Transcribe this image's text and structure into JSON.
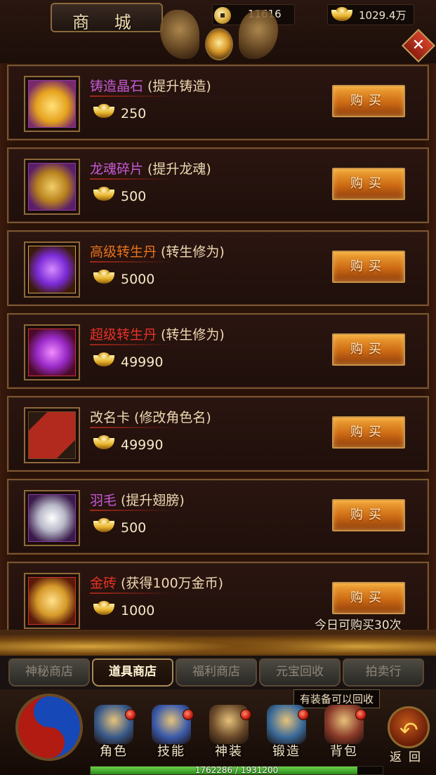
{
  "header": {
    "title": "商 城",
    "coins": "11616",
    "ingots": "1029.4万",
    "close_icon": "close-icon"
  },
  "items": [
    {
      "name": "铸造晶石",
      "desc": "(提升铸造)",
      "price": "250",
      "buy": "购买",
      "name_color": "#c65ad6",
      "icon": "crystal-icon"
    },
    {
      "name": "龙魂碎片",
      "desc": "(提升龙魂)",
      "price": "500",
      "buy": "购买",
      "name_color": "#c65ad6",
      "icon": "dragon-soul-icon"
    },
    {
      "name": "高级转生丹",
      "desc": "(转生修为)",
      "price": "5000",
      "buy": "购买",
      "name_color": "#e6731e",
      "icon": "rebirth-pill-icon"
    },
    {
      "name": "超级转生丹",
      "desc": "(转生修为)",
      "price": "49990",
      "buy": "购买",
      "name_color": "#e63226",
      "icon": "super-rebirth-pill-icon"
    },
    {
      "name": "改名卡",
      "desc": "(修改角色名)",
      "price": "49990",
      "buy": "购买",
      "name_color": "#f1ddb5",
      "icon": "rename-card-icon"
    },
    {
      "name": "羽毛",
      "desc": "(提升翅膀)",
      "price": "500",
      "buy": "购买",
      "name_color": "#c65ad6",
      "icon": "feather-icon"
    },
    {
      "name": "金砖",
      "desc": "(获得100万金币)",
      "price": "1000",
      "buy": "购买",
      "name_color": "#e63226",
      "icon": "gold-brick-icon"
    }
  ],
  "limit_text": "今日可购买30次",
  "tabs": [
    {
      "label": "神秘商店",
      "active": false
    },
    {
      "label": "道具商店",
      "active": true
    },
    {
      "label": "福利商店",
      "active": false
    },
    {
      "label": "元宝回收",
      "active": false
    },
    {
      "label": "拍卖行",
      "active": false
    }
  ],
  "hint": "有装备可以回收",
  "nav": [
    {
      "label": "角色",
      "icon": "helmet-icon"
    },
    {
      "label": "技能",
      "icon": "skill-book-icon"
    },
    {
      "label": "神装",
      "icon": "armor-icon"
    },
    {
      "label": "锻造",
      "icon": "anvil-icon"
    },
    {
      "label": "背包",
      "icon": "backpack-icon"
    }
  ],
  "back_label": "返回",
  "exp": {
    "text": "1762286 / 1931200",
    "fraction": 0.9125
  }
}
